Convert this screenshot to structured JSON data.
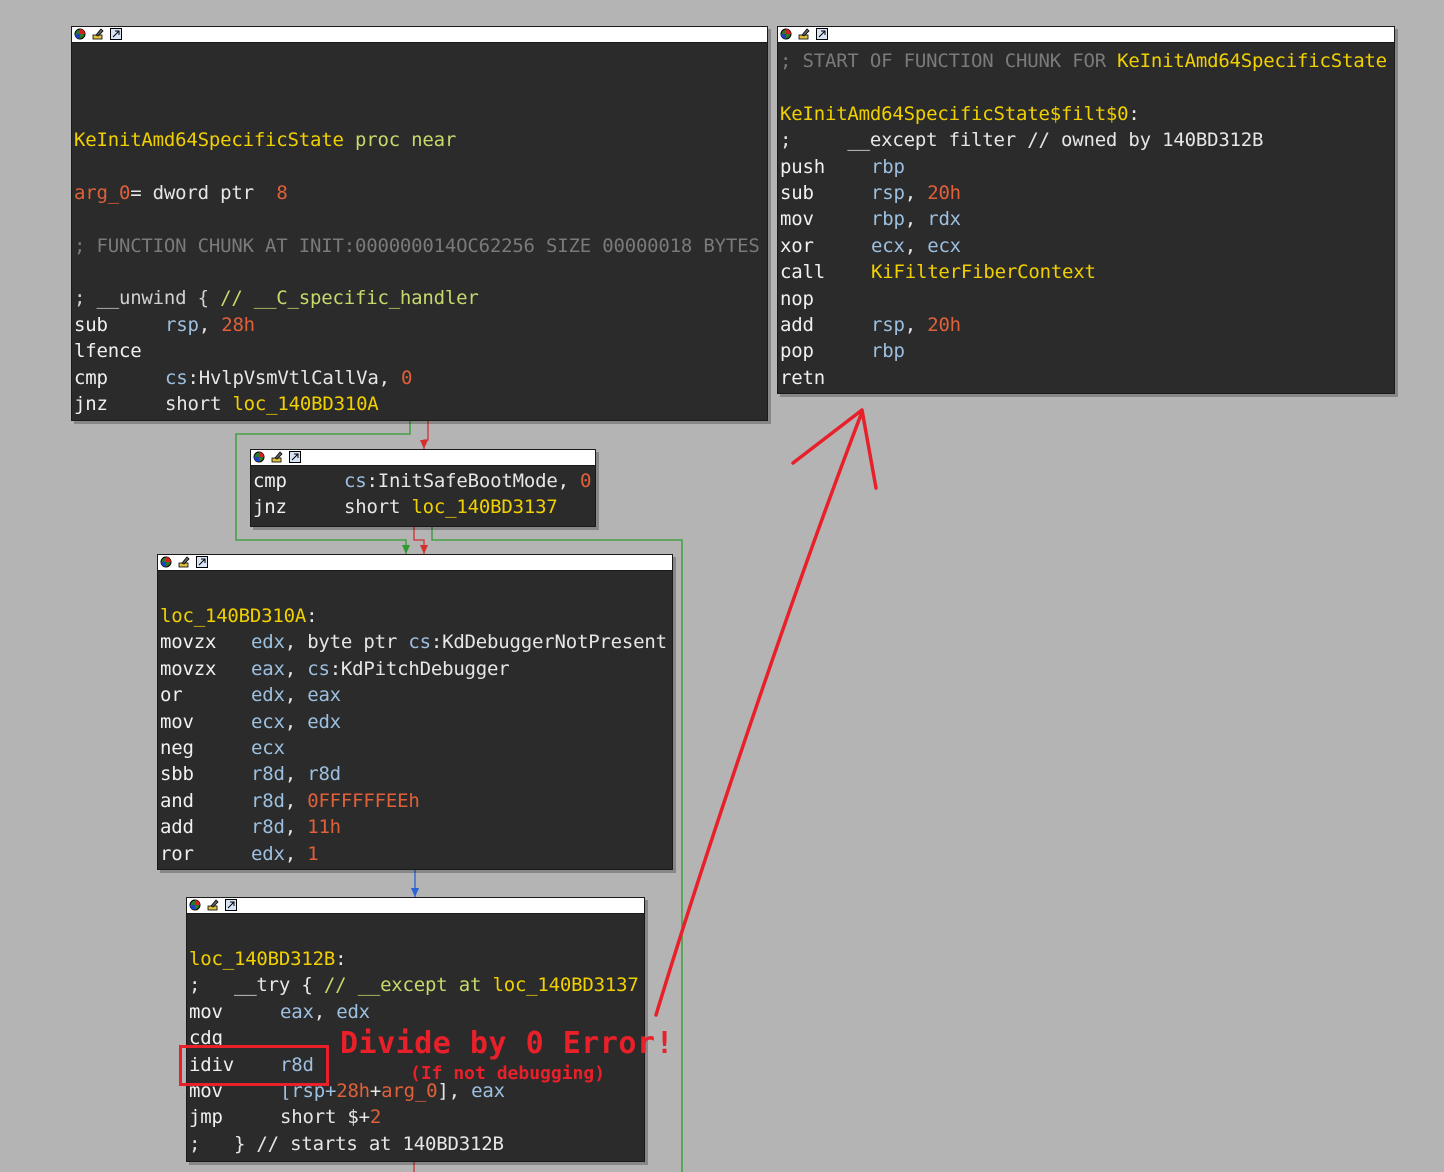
{
  "nodes": {
    "n1": {
      "l1": {
        "a": "KeInitAmd64SpecificState",
        "b": " proc near"
      },
      "l2": {
        "a": "arg_0",
        "b": "= dword ptr  ",
        "c": "8"
      },
      "l3": "; FUNCTION CHUNK AT INIT:000000014OC62256 SIZE 00000018 BYTES",
      "l4": {
        "a": "; __unwind { ",
        "b": "// __C_specific_handler"
      },
      "l5": {
        "m": "sub",
        "r": "rsp",
        "s": ", ",
        "n": "28h"
      },
      "l6": {
        "m": "lfence"
      },
      "l7": {
        "m": "cmp",
        "r": "cs",
        "s": ":",
        "o": "HvlpVsmVtlCallVa",
        "s2": ", ",
        "n": "0"
      },
      "l8": {
        "m": "jnz",
        "o": "short ",
        "lb": "loc_140BD310A"
      }
    },
    "n2": {
      "l1": {
        "m": "cmp",
        "r": "cs",
        "s": ":",
        "o": "InitSafeBootMode",
        "s2": ", ",
        "n": "0"
      },
      "l2": {
        "m": "jnz",
        "o": "short ",
        "lb": "loc_140BD3137"
      }
    },
    "n3": {
      "label": "loc_140BD310A",
      "colon": ":",
      "rows": [
        {
          "m": "movzx",
          "a": "edx",
          "b": ", byte ptr ",
          "c": "cs",
          "d": ":KdDebuggerNotPresent"
        },
        {
          "m": "movzx",
          "a": "eax",
          "b": ", ",
          "c": "cs",
          "d": ":KdPitchDebugger"
        },
        {
          "m": "or",
          "a": "edx",
          "b": ", ",
          "c": "eax"
        },
        {
          "m": "mov",
          "a": "ecx",
          "b": ", ",
          "c": "edx"
        },
        {
          "m": "neg",
          "a": "ecx"
        },
        {
          "m": "sbb",
          "a": "r8d",
          "b": ", ",
          "c": "r8d"
        },
        {
          "m": "and",
          "a": "r8d",
          "b": ", ",
          "n": "0FFFFFFEEh"
        },
        {
          "m": "add",
          "a": "r8d",
          "b": ", ",
          "n": "11h"
        },
        {
          "m": "ror",
          "a": "edx",
          "b": ", ",
          "n": "1"
        }
      ]
    },
    "n4": {
      "label": "loc_140BD312B",
      "colon": ":",
      "try": {
        "a": ";   __try { ",
        "b": "// __except at ",
        "c": "loc_140BD3137"
      },
      "l_mov": {
        "m": "mov",
        "a": "eax",
        "b": ", ",
        "c": "edx"
      },
      "l_cdq": {
        "m": "cdq"
      },
      "l_idiv": {
        "m": "idiv",
        "a": "r8d"
      },
      "l_mov2": {
        "m": "mov",
        "a": "[rsp+",
        "n": "28h",
        "b": "+",
        "c": "arg_0",
        "d": "], ",
        "e": "eax"
      },
      "l_jmp": {
        "m": "jmp",
        "a": "short $+",
        "n": "2"
      },
      "end": ";   } // starts at 140BD312B"
    },
    "n5": {
      "header": {
        "a": "; START OF FUNCTION CHUNK FOR ",
        "b": "KeInitAmd64SpecificState"
      },
      "label": "KeInitAmd64SpecificState$filt$0",
      "colon": ":",
      "except": ";     __except filter // owned by 140BD312B",
      "rows": [
        {
          "m": "push",
          "a": "rbp"
        },
        {
          "m": "sub",
          "a": "rsp",
          "b": ", ",
          "n": "20h"
        },
        {
          "m": "mov",
          "a": "rbp",
          "b": ", ",
          "c": "rdx"
        },
        {
          "m": "xor",
          "a": "ecx",
          "b": ", ",
          "c": "ecx"
        },
        {
          "m": "call",
          "lb": "KiFilterFiberContext"
        },
        {
          "m": "nop"
        },
        {
          "m": "add",
          "a": "rsp",
          "b": ", ",
          "n": "20h"
        },
        {
          "m": "pop",
          "a": "rbp"
        },
        {
          "m": "retn"
        }
      ]
    }
  },
  "annotation": {
    "title": "Divide by 0 Error!",
    "subtitle": "(If not debugging)"
  },
  "colors": {
    "background": "#b4b4b4",
    "node_bg": "#2b2b2b",
    "label": "#f1d000",
    "register": "#9dc0e0",
    "number": "#e0603a",
    "annotation": "#e8202a",
    "edge_true": "#2f9c2f",
    "edge_false": "#d23030",
    "edge_flow": "#2a62d8"
  },
  "icons": [
    "graph-node-color-icon",
    "graph-node-rename-icon",
    "graph-node-collapse-icon"
  ]
}
